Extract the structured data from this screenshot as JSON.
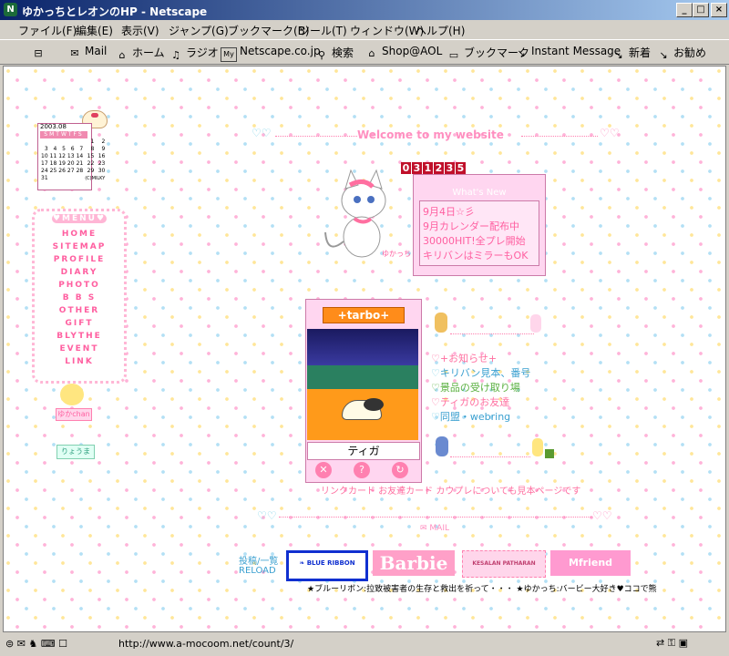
{
  "window": {
    "title": "ゆかっちとレオンのHP - Netscape",
    "minimize": "_",
    "maximize": "□",
    "close": "×"
  },
  "menu": [
    "ファイル(F)",
    "編集(E)",
    "表示(V)",
    "ジャンプ(G)",
    "ブックマーク(B)",
    "ツール(T)",
    "ウィンドウ(W)",
    "ヘルプ(H)"
  ],
  "toolbar": {
    "items": [
      "Mail",
      "ホーム",
      "ラジオ",
      "Netscape.co.jp",
      "検索",
      "Shop@AOL",
      "ブックマーク",
      "Instant Message",
      "新着",
      "お勧め"
    ]
  },
  "calendar": {
    "month": "2003.08",
    "weekdays": [
      "S",
      "M",
      "T",
      "W",
      "T",
      "F",
      "S"
    ],
    "rows": [
      [
        "",
        "",
        "",
        "",
        "",
        "1",
        "2"
      ],
      [
        "3",
        "4",
        "5",
        "6",
        "7",
        "8",
        "9"
      ],
      [
        "10",
        "11",
        "12",
        "13",
        "14",
        "15",
        "16"
      ],
      [
        "17",
        "18",
        "19",
        "20",
        "21",
        "22",
        "23"
      ],
      [
        "24",
        "25",
        "26",
        "27",
        "28",
        "29",
        "30"
      ],
      [
        "31",
        "",
        "",
        "",
        "",
        "",
        ""
      ]
    ],
    "credit": "(C)MILKY"
  },
  "sidemenu": {
    "title": "♥MENU♥",
    "items": [
      "HOME",
      "SITEMAP",
      "PROFILE",
      "DIARY",
      "PHOTO",
      "B B S",
      "OTHER",
      "GIFT",
      "BLYTHE",
      "EVENT",
      "LINK"
    ]
  },
  "buttons": {
    "yuka": "ゆかchan",
    "ryo": "りょうま"
  },
  "welcome": "Welcome to my website",
  "counter": [
    "0",
    "3",
    "1",
    "2",
    "3",
    "5"
  ],
  "mascot_caption": "ゆかっち",
  "whatsnew": {
    "title": "What's New",
    "lines": [
      "9月4日☆彡",
      "9月カレンダー配布中",
      "30000HIT!全プレ開始",
      "キリバンはミラーもOK"
    ]
  },
  "card": {
    "logo": "+tarbo+",
    "name": "ティガ"
  },
  "links": [
    "+お知らせ+",
    "キリバン見本、番号",
    "景品の受け取り場",
    "ティガのお友達",
    "同盟・webring"
  ],
  "cardnote": "リンクカード お友達カード カウプレについても見本ページです",
  "mail": "MAIL",
  "bottomlinks": {
    "line1": "投稿/一覧",
    "line2": "RELOAD"
  },
  "banners": {
    "blueribbon": "BLUE RIBBON",
    "barbie": "Barbie",
    "kesalan": "KESALAN PATHARAN",
    "mfriend": "Mfriend"
  },
  "footer": "★ブルーリボン:拉致被害者の生存と救出を祈って・・・  ★ゆかっち:バービー大好き♥ココで熊",
  "status": {
    "url": "http://www.a-mocoom.net/count/3/"
  }
}
